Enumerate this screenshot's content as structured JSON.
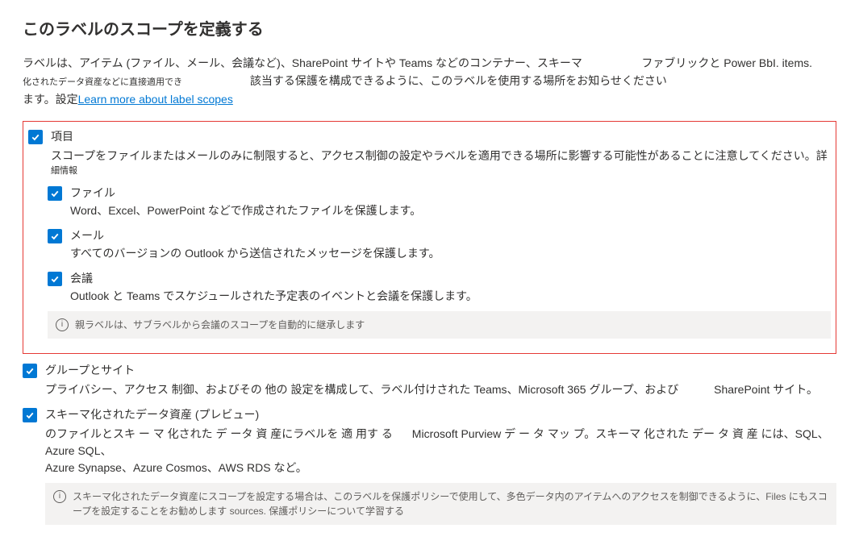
{
  "title": "このラベルのスコープを定義する",
  "intro": {
    "line1": "ラベルは、アイテム (ファイル、メール、会議など)、SharePoint サイトや Teams などのコンテナー、スキーマ",
    "line1_right": "ファブリックと Power BbI. items.",
    "line1_sub": "化されたデータ資産などに直接適用でき",
    "line2_part": "該当する保護を構成できるように、このラベルを使用する場所をお知らせください",
    "line3": "ます。設定",
    "learn_link": "Learn more about label scopes"
  },
  "items_section": {
    "label": "項目",
    "desc": "スコープをファイルまたはメールのみに制限すると、アクセス制御の設定やラベルを適用できる場所に影響する可能性があることに注意してください。詳",
    "more": "細情報",
    "files": {
      "label": "ファイル",
      "desc": "Word、Excel、PowerPoint などで作成されたファイルを保護します。"
    },
    "email": {
      "label": "メール",
      "desc": "すべてのバージョンの Outlook から送信されたメッセージを保護します。"
    },
    "meetings": {
      "label": "会議",
      "desc": "Outlook と Teams でスケジュールされた予定表のイベントと会議を保護します。",
      "info": "親ラベルは、サブラベルから会議のスコープを自動的に継承します"
    }
  },
  "groups_section": {
    "label": "グループとサイト",
    "desc_a": "プライバシー、アクセス 制御、およびその 他の 設定を構成して、ラベル付けされた Teams、Microsoft 365 グループ、および",
    "desc_b": "SharePoint サイト。"
  },
  "schema_section": {
    "label": "スキーマ化されたデータ資産 (プレビュー)",
    "desc_a": "のファイルとスキ ー マ 化された デ ータ 資 産にラベルを 適 用す る",
    "desc_b": "Microsoft Purview デ ー タ マッ プ。スキーマ 化された デー タ 資 産 には、SQL、Azure SQL、",
    "desc_c": "Azure Synapse、Azure Cosmos、AWS RDS など。",
    "info": "スキーマ化されたデータ資産にスコープを設定する場合は、このラベルを保護ポリシーで使用して、多色データ内のアイテムへのアクセスを制御できるように、Files にもスコープを設定することをお勧めします sources. 保護ポリシーについて学習する"
  }
}
